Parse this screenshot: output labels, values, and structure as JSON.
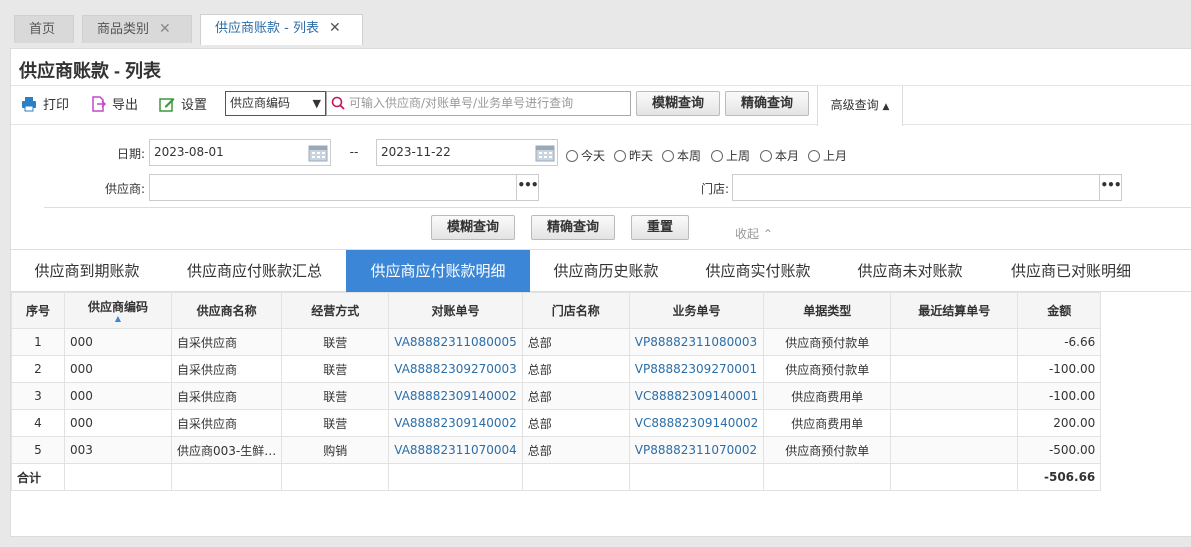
{
  "tabs": [
    {
      "label": "首页",
      "closable": false
    },
    {
      "label": "商品类别",
      "closable": true
    },
    {
      "label": "供应商账款 - 列表",
      "closable": true,
      "active": true
    }
  ],
  "page_title": "供应商账款 - 列表",
  "toolbar": {
    "print": "打印",
    "export": "导出",
    "settings": "设置",
    "select_value": "供应商编码",
    "search_placeholder": "可输入供应商/对账单号/业务单号进行查询",
    "fuzzy": "模糊查询",
    "exact": "精确查询",
    "advanced": "高级查询"
  },
  "filters": {
    "date_label": "日期:",
    "date_from": "2023-08-01",
    "date_sep": "--",
    "date_to": "2023-11-22",
    "quick_dates": [
      "今天",
      "昨天",
      "本周",
      "上周",
      "本月",
      "上月"
    ],
    "supplier_label": "供应商:",
    "store_label": "门店:",
    "fuzzy": "模糊查询",
    "exact": "精确查询",
    "reset": "重置",
    "collapse": "收起"
  },
  "subtabs": [
    "供应商到期账款",
    "供应商应付账款汇总",
    "供应商应付账款明细",
    "供应商历史账款",
    "供应商实付账款",
    "供应商未对账款",
    "供应商已对账明细"
  ],
  "table": {
    "headers": [
      "序号",
      "供应商编码",
      "供应商名称",
      "经营方式",
      "对账单号",
      "门店名称",
      "业务单号",
      "单据类型",
      "最近结算单号",
      "金额"
    ],
    "rows": [
      [
        "1",
        "000",
        "自采供应商",
        "联营",
        "VA88882311080005",
        "总部",
        "VP88882311080003",
        "供应商预付款单",
        "",
        "-6.66"
      ],
      [
        "2",
        "000",
        "自采供应商",
        "联营",
        "VA88882309270003",
        "总部",
        "VP88882309270001",
        "供应商预付款单",
        "",
        "-100.00"
      ],
      [
        "3",
        "000",
        "自采供应商",
        "联营",
        "VA88882309140002",
        "总部",
        "VC88882309140001",
        "供应商费用单",
        "",
        "-100.00"
      ],
      [
        "4",
        "000",
        "自采供应商",
        "联营",
        "VA88882309140002",
        "总部",
        "VC88882309140002",
        "供应商费用单",
        "",
        "200.00"
      ],
      [
        "5",
        "003",
        "供应商003-生鲜…",
        "购销",
        "VA88882311070004",
        "总部",
        "VP88882311070002",
        "供应商预付款单",
        "",
        "-500.00"
      ]
    ],
    "total_label": "合计",
    "total_amount": "-506.66"
  },
  "colors": {
    "accent": "#3b86d6",
    "link": "#2b6ea8"
  }
}
